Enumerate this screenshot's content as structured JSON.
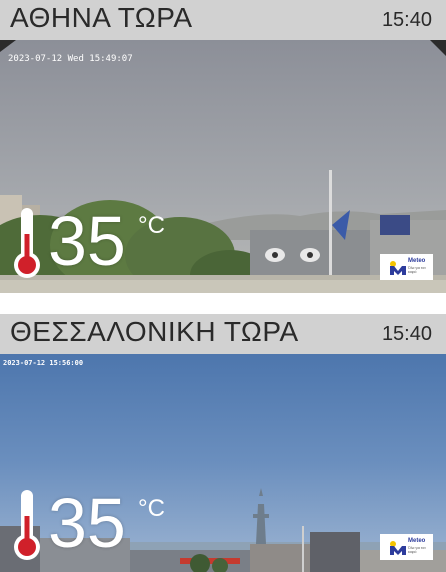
{
  "cams": [
    {
      "title": "ΑΘΗΝΑ ΤΩΡΑ",
      "time": "15:40",
      "timestamp": "2023-07-12 Wed 15:49:07",
      "temperature": "35",
      "unit": "°C",
      "logo": {
        "brand": "Meteo",
        "sub": "Όλα για τον καιρό"
      }
    },
    {
      "title": "ΘΕΣΣΑΛΟΝΙΚΗ ΤΩΡΑ",
      "time": "15:40",
      "timestamp": "2023-07-12 15:56:00",
      "temperature": "35",
      "unit": "°C",
      "logo": {
        "brand": "Meteo",
        "sub": "Όλα για τον καιρό"
      }
    }
  ],
  "colors": {
    "header_bg": "#d1d1d1",
    "thermometer_red": "#d0202a",
    "logo_blue": "#2d3c9c",
    "logo_yellow": "#f5c400"
  }
}
